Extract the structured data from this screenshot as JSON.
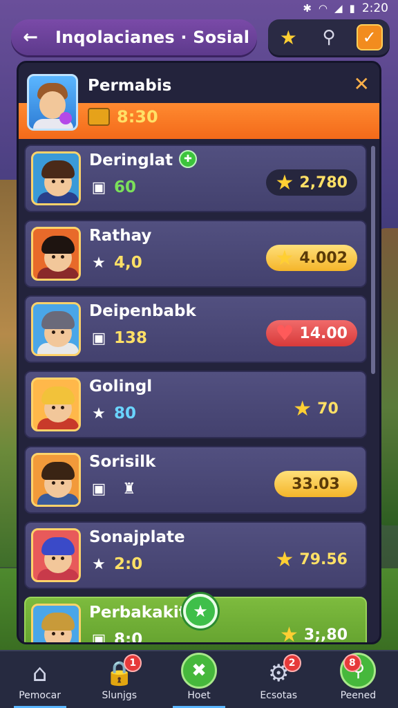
{
  "status_bar": {
    "time": "2:20",
    "icons": [
      "bluetooth-icon",
      "wifi-icon",
      "signal-icon",
      "battery-icon"
    ]
  },
  "header": {
    "back_glyph": "←",
    "title": "Inqolacianes · Sosial",
    "icons": [
      "star-icon",
      "search-icon",
      "checkbox-icon"
    ]
  },
  "panel": {
    "player": {
      "name": "Permabis",
      "currency": "8:30",
      "close_glyph": "✕"
    },
    "rows": [
      {
        "name": "Deringlat",
        "stat": "60",
        "stat_color": "#7be05a",
        "score": "2,780",
        "score_style": "dark",
        "has_star": true,
        "badge": true,
        "avatar": {
          "hair": "#4a2a18",
          "body": "#2a3f8a",
          "bg": "#3a9ad8"
        }
      },
      {
        "name": "Rathay",
        "stat": "4,0",
        "stat_color": "#ffe066",
        "score": "4.002",
        "score_style": "gold",
        "has_star": true,
        "avatar": {
          "hair": "#1e1410",
          "body": "#8a2a2a",
          "bg": "#e86a2a"
        }
      },
      {
        "name": "Deipenbabk",
        "stat": "138",
        "stat_color": "#ffe066",
        "score": "14.00",
        "score_style": "red",
        "has_heart": true,
        "avatar": {
          "hair": "#6a6a7a",
          "body": "#e8e8e8",
          "bg": "#4aa6e8"
        }
      },
      {
        "name": "Golingl",
        "stat": "80",
        "stat_color": "#6ad4ff",
        "score": "70",
        "score_style": "plain",
        "has_star": true,
        "avatar": {
          "hair": "#f2c23a",
          "body": "#c83a2a",
          "bg": "#ffb84a"
        }
      },
      {
        "name": "Sorisilk",
        "stat": "",
        "stat_color": "#ffe066",
        "score": "33.03",
        "score_style": "gold",
        "avatar": {
          "hair": "#3a2414",
          "body": "#3a5a9a",
          "bg": "#f29a3a"
        }
      },
      {
        "name": "Sonajplate",
        "stat": "2:0",
        "stat_color": "#ffe066",
        "score": "79.56",
        "score_style": "plain",
        "has_star": true,
        "avatar": {
          "hair": "#3a4ac8",
          "body": "#c83a4a",
          "bg": "#e85a5a"
        }
      },
      {
        "name": "Perbakakit",
        "stat": "8;0",
        "stat_color": "#ffffff",
        "score": "3;,80",
        "score_style": "plain",
        "has_star": true,
        "active": true,
        "avatar": {
          "hair": "#c89a3a",
          "body": "#3a7ac8",
          "bg": "#4aa6e8"
        }
      }
    ]
  },
  "bottom_nav": [
    {
      "label": "Pemocar",
      "icon": "home-icon",
      "glyph": "⌂",
      "badge": "",
      "selected": true
    },
    {
      "label": "Slunjgs",
      "icon": "lock-icon",
      "glyph": "🔒",
      "badge": "1"
    },
    {
      "label": "Hoet",
      "icon": "close-circle-icon",
      "glyph": "✖",
      "badge": "",
      "green": true,
      "selected": true
    },
    {
      "label": "Ecsotas",
      "icon": "gear-icon",
      "glyph": "⚙",
      "badge": "2"
    },
    {
      "label": "Peened",
      "icon": "add-friend-icon",
      "glyph": "⚲",
      "badge": "8",
      "green": true
    }
  ]
}
